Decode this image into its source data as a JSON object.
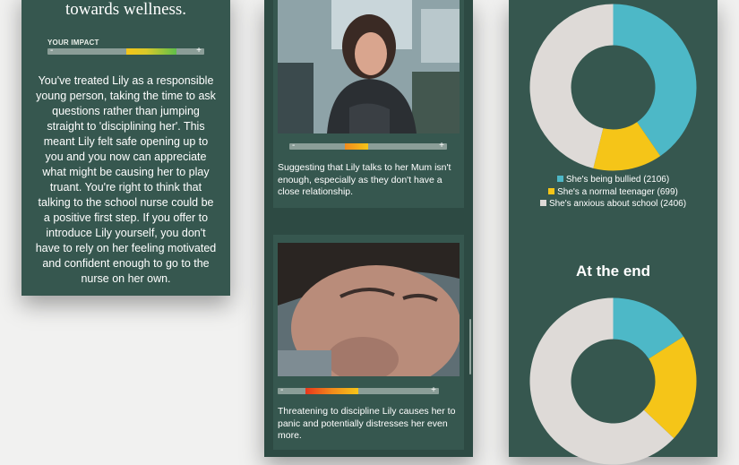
{
  "left_panel": {
    "heading": "towards wellness.",
    "impact_label": "YOUR IMPACT",
    "minus": "-",
    "plus": "+",
    "impact_level": 0.66,
    "body": "You've treated Lily as a responsible young person, taking the time to ask questions rather than jumping straight to 'disciplining her'. This meant Lily felt safe opening up to you and you now can appreciate what might be causing her to play truant. You're right to think that talking to the school nurse could be a positive first step. If you offer to introduce Lily yourself, you don't have to rely on her feeling motivated and confident enough to go to the nurse on her own."
  },
  "middle_panel": {
    "cards": [
      {
        "image_alt": "girl-on-bus-photo",
        "minus": "-",
        "plus": "+",
        "meter_range": [
          0.35,
          0.5
        ],
        "caption": "Suggesting that Lily talks to her Mum isn't enough, especially as they don't have a close relationship."
      },
      {
        "image_alt": "girl-biting-nails-photo",
        "minus": "-",
        "plus": "+",
        "meter_range": [
          0.17,
          0.5
        ],
        "caption": "Threatening to discipline Lily causes her to panic and potentially distresses her even more."
      }
    ]
  },
  "right_panel": {
    "legend": [
      {
        "label": "She's being bullied",
        "count": "(2106)",
        "color": "#4db8c7"
      },
      {
        "label": "She's a normal teenager",
        "count": "(699)",
        "color": "#f5c518"
      },
      {
        "label": "She's anxious about school",
        "count": "(2406)",
        "color": "#dedad7"
      }
    ],
    "at_the_end": "At the end"
  },
  "chart_data": [
    {
      "type": "pie",
      "categories": [
        "She's being bullied",
        "She's a normal teenager",
        "She's anxious about school"
      ],
      "values": [
        2106,
        699,
        2406
      ],
      "colors": [
        "#4db8c7",
        "#f5c518",
        "#dedad7"
      ]
    },
    {
      "type": "pie",
      "title": "At the end",
      "categories": [
        "She's being bullied",
        "She's a normal teenager",
        "She's anxious about school"
      ],
      "values": [
        0.16,
        0.21,
        0.63
      ],
      "colors": [
        "#4db8c7",
        "#f5c518",
        "#dedad7"
      ]
    }
  ]
}
